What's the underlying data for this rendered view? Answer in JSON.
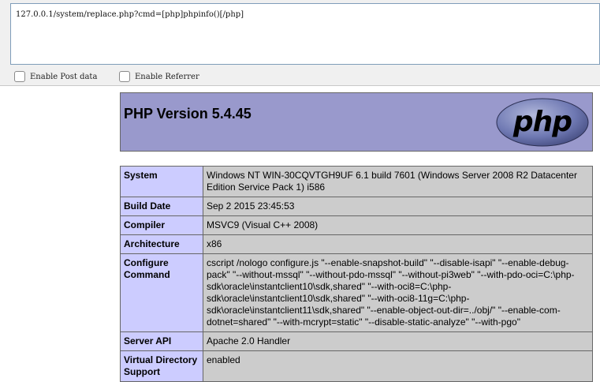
{
  "toolbar": {
    "url": "127.0.0.1/system/replace.php?cmd=[php]phpinfo()[/php]",
    "enable_post_label": "Enable Post data",
    "enable_referrer_label": "Enable Referrer"
  },
  "phpinfo": {
    "title": "PHP Version 5.4.45",
    "logo_text": "php",
    "rows": [
      {
        "key": "System",
        "value": "Windows NT WIN-30CQVTGH9UF 6.1 build 7601 (Windows Server 2008 R2 Datacenter Edition Service Pack 1) i586"
      },
      {
        "key": "Build Date",
        "value": "Sep 2 2015 23:45:53"
      },
      {
        "key": "Compiler",
        "value": "MSVC9 (Visual C++ 2008)"
      },
      {
        "key": "Architecture",
        "value": "x86"
      },
      {
        "key": "Configure Command",
        "value": "cscript /nologo configure.js \"--enable-snapshot-build\" \"--disable-isapi\" \"--enable-debug-pack\" \"--without-mssql\" \"--without-pdo-mssql\" \"--without-pi3web\" \"--with-pdo-oci=C:\\php-sdk\\oracle\\instantclient10\\sdk,shared\" \"--with-oci8=C:\\php-sdk\\oracle\\instantclient10\\sdk,shared\" \"--with-oci8-11g=C:\\php-sdk\\oracle\\instantclient11\\sdk,shared\" \"--enable-object-out-dir=../obj/\" \"--enable-com-dotnet=shared\" \"--with-mcrypt=static\" \"--disable-static-analyze\" \"--with-pgo\""
      },
      {
        "key": "Server API",
        "value": "Apache 2.0 Handler"
      },
      {
        "key": "Virtual Directory Support",
        "value": "enabled"
      }
    ]
  }
}
